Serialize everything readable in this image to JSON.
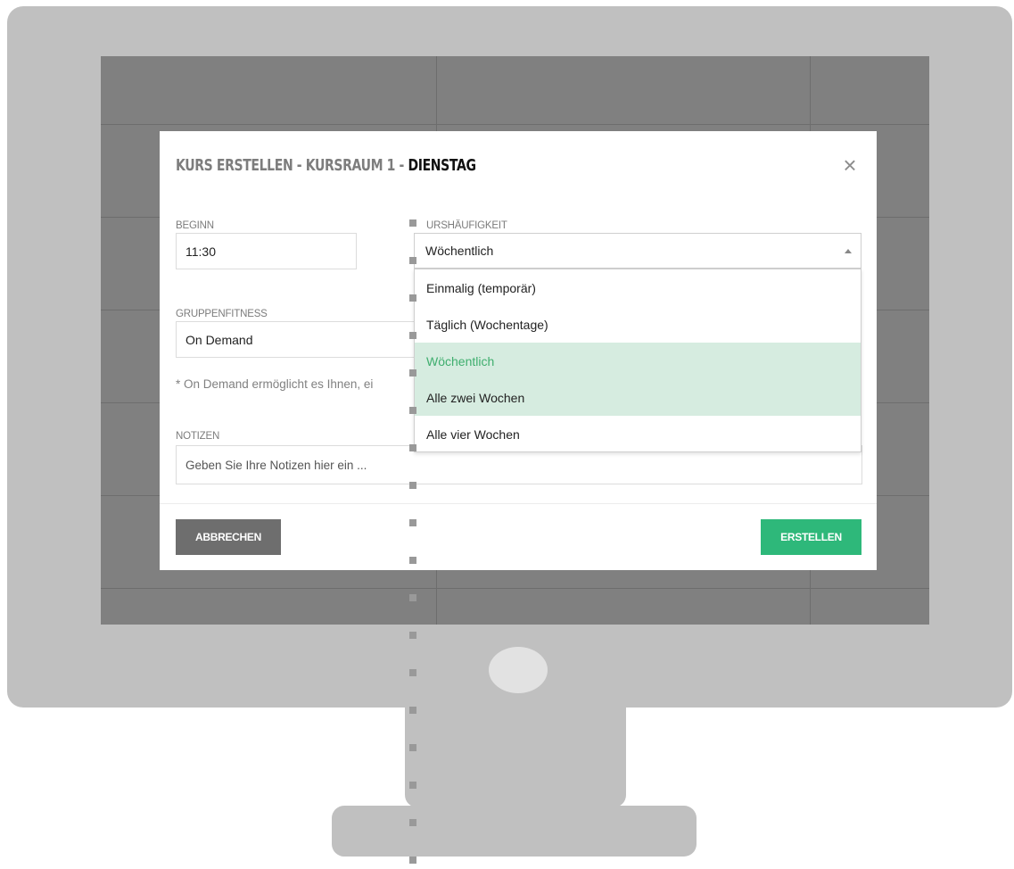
{
  "modal": {
    "title_gray": "KURS ERSTELLEN - KURSRAUM 1 - ",
    "title_dark": "DIENSTAG",
    "close_symbol": "×",
    "beginn": {
      "label": "BEGINN",
      "value": "11:30"
    },
    "kurshaeufigkeit": {
      "label": "URSHÄUFIGKEIT",
      "value": "Wöchentlich",
      "options": [
        "Einmalig (temporär)",
        "Täglich (Wochentage)",
        "Wöchentlich",
        "Alle zwei Wochen",
        "Alle vier Wochen"
      ],
      "selected_index": 2,
      "hover_index": 3
    },
    "gruppenfitness": {
      "label": "GRUPPENFITNESS",
      "value": "On Demand"
    },
    "hint": "* On Demand ermöglicht es Ihnen, ei",
    "notizen": {
      "label": "NOTIZEN",
      "placeholder": "Geben Sie Ihre Notizen hier ein ..."
    },
    "buttons": {
      "cancel": "ABBRECHEN",
      "create": "ERSTELLEN"
    }
  },
  "colors": {
    "accent_green": "#2eb87a",
    "selected_bg": "#d6ece0",
    "cancel_gray": "#6e6e6e"
  },
  "icons": {
    "close": "close-icon",
    "dropdown_caret": "caret-up-icon"
  }
}
